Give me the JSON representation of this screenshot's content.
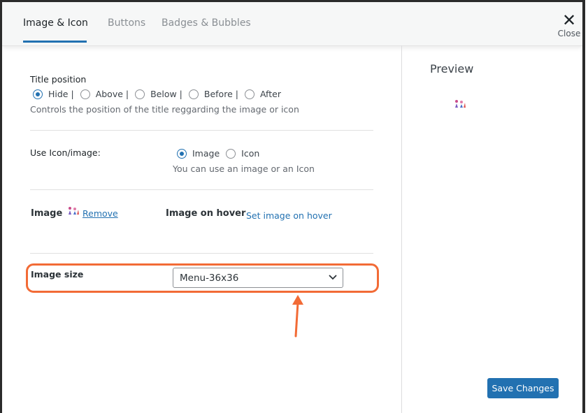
{
  "tabs": [
    {
      "label": "Image & Icon",
      "active": true
    },
    {
      "label": "Buttons",
      "active": false
    },
    {
      "label": "Badges & Bubbles",
      "active": false
    }
  ],
  "close": {
    "symbol": "✕",
    "label": "Close"
  },
  "title_position": {
    "label": "Title position",
    "options": [
      {
        "label": "Hide |",
        "checked": true
      },
      {
        "label": "Above |",
        "checked": false
      },
      {
        "label": "Below |",
        "checked": false
      },
      {
        "label": "Before |",
        "checked": false
      },
      {
        "label": "After",
        "checked": false
      }
    ],
    "description": "Controls the position of the title reggarding the image or icon"
  },
  "use_icon_image": {
    "label": "Use Icon/image:",
    "options": [
      {
        "label": "Image",
        "checked": true
      },
      {
        "label": "Icon",
        "checked": false
      }
    ],
    "description": "You can use an image or an Icon"
  },
  "image": {
    "label": "Image",
    "remove_link": "Remove",
    "hover_label": "Image on hover",
    "hover_link": "Set image on hover"
  },
  "image_size": {
    "label": "Image size",
    "selected": "Menu-36x36"
  },
  "preview": {
    "title": "Preview"
  },
  "save_button": "Save Changes",
  "colors": {
    "accent": "#2271b1",
    "highlight": "#f26b36"
  }
}
